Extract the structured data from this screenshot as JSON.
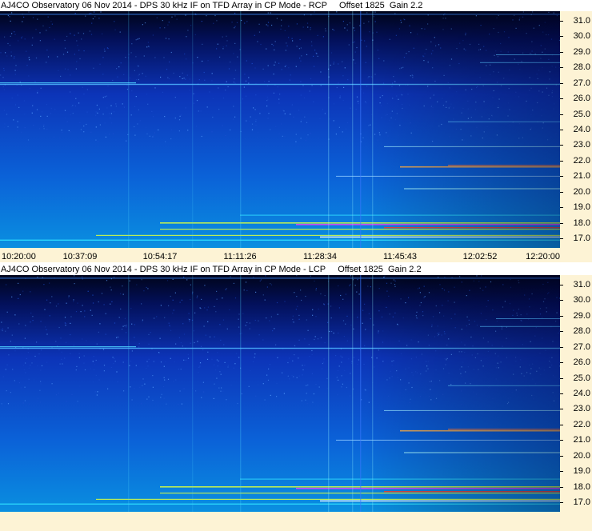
{
  "colors": {
    "background_dark": "#00041a",
    "background_mid": "#0a2aa8",
    "background_light": "#0a8fe0",
    "axis_bg": "#fdf3d5",
    "band_cyan": "#2fe0ff",
    "band_yellow": "#d8ff40",
    "band_magenta": "#ff3cff",
    "band_red": "#ff3c28"
  },
  "chart_data": [
    {
      "type": "heatmap",
      "title": "AJ4CO Observatory 06 Nov 2014 - DPS 30 kHz IF on TFD Array in CP Mode - RCP     Offset 1825  Gain 2.2",
      "xlabel": "",
      "ylabel": "",
      "x_ticks": [
        "10:20:00",
        "10:37:09",
        "10:54:17",
        "11:11:26",
        "11:28:34",
        "11:45:43",
        "12:02:52",
        "12:20:00"
      ],
      "y_ticks": [
        "31.0",
        "30.0",
        "29.0",
        "28.0",
        "27.0",
        "26.0",
        "25.0",
        "24.0",
        "23.0",
        "22.0",
        "21.0",
        "20.0",
        "19.0",
        "18.0",
        "17.0"
      ],
      "ylim": [
        16.4,
        31.6
      ],
      "grid": false,
      "legend": "none"
    },
    {
      "type": "heatmap",
      "title": "AJ4CO Observatory 06 Nov 2014 - DPS 30 kHz IF on TFD Array in CP Mode - LCP     Offset 1825  Gain 2.2",
      "xlabel": "",
      "ylabel": "",
      "x_ticks": [],
      "y_ticks": [
        "31.0",
        "30.0",
        "29.0",
        "28.0",
        "27.0",
        "26.0",
        "25.0",
        "24.0",
        "23.0",
        "22.0",
        "21.0",
        "20.0",
        "19.0",
        "18.0",
        "17.0"
      ],
      "ylim": [
        16.4,
        31.6
      ],
      "grid": false,
      "legend": "none"
    }
  ]
}
